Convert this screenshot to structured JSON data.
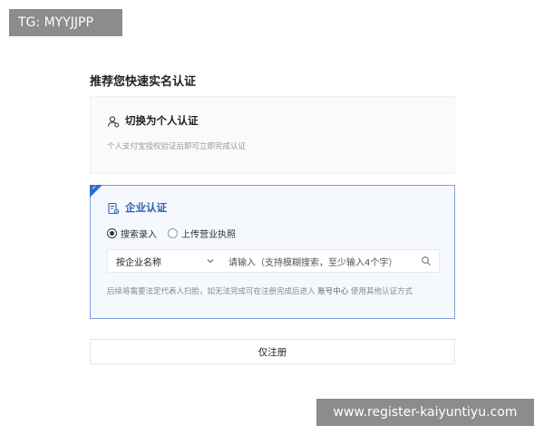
{
  "watermarks": {
    "top_left": "TG: MYYJJPP",
    "bottom_right": "www.register-kaiyuntiyu.com"
  },
  "page": {
    "title": "推荐您快速实名认证"
  },
  "personal_card": {
    "icon": "user-icon",
    "title": "切换为个人认证",
    "description": "个人支付宝授权验证后即可立即完成认证"
  },
  "company_card": {
    "icon": "company-doc-icon",
    "title": "企业认证",
    "radios": [
      {
        "label": "搜索录入",
        "checked": true
      },
      {
        "label": "上传营业执照",
        "checked": false
      }
    ],
    "search": {
      "select_value": "按企业名称",
      "placeholder": "请输入（支持模糊搜索，至少输入4个字）"
    },
    "hint_prefix": "后续将需要法定代表人扫脸，如无法完成可在注册完成后进入",
    "hint_link": "账号中心",
    "hint_suffix": "使用其他认证方式"
  },
  "register_button": {
    "label": "仅注册"
  },
  "colors": {
    "accent": "#2f6bd8",
    "company_title": "#2c5fb8",
    "selected_border": "#7fa0d8"
  }
}
